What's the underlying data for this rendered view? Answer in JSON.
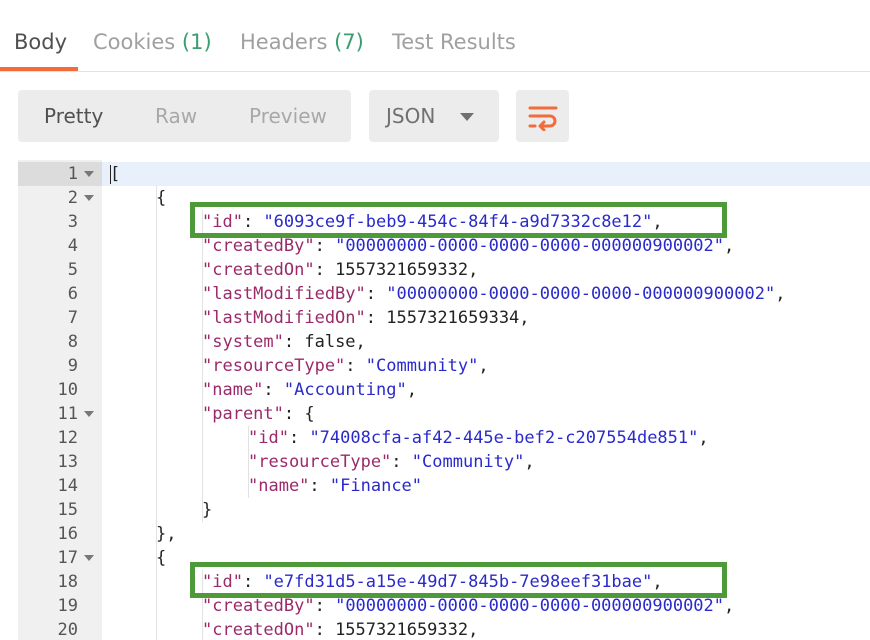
{
  "tabs": [
    {
      "label": "Body",
      "count": ""
    },
    {
      "label": "Cookies",
      "count": "(1)"
    },
    {
      "label": "Headers",
      "count": "(7)"
    },
    {
      "label": "Test Results",
      "count": ""
    }
  ],
  "toolbar": {
    "view_modes": [
      "Pretty",
      "Raw",
      "Preview"
    ],
    "active_view": "Pretty",
    "format": "JSON",
    "wrap_icon": "wrap-lines-icon",
    "accent_color": "#f26b3a"
  },
  "editor": {
    "line_numbers": [
      "1",
      "2",
      "3",
      "4",
      "5",
      "6",
      "7",
      "8",
      "9",
      "10",
      "11",
      "12",
      "13",
      "14",
      "15",
      "16",
      "17",
      "18",
      "19",
      "20"
    ],
    "lines": [
      [
        {
          "t": "p",
          "v": "["
        }
      ],
      [
        {
          "t": "p",
          "v": "{"
        }
      ],
      [
        {
          "t": "k",
          "v": "\"id\""
        },
        {
          "t": "p",
          "v": ": "
        },
        {
          "t": "s",
          "v": "\"6093ce9f-beb9-454c-84f4-a9d7332c8e12\""
        },
        {
          "t": "p",
          "v": ","
        }
      ],
      [
        {
          "t": "k",
          "v": "\"createdBy\""
        },
        {
          "t": "p",
          "v": ": "
        },
        {
          "t": "s",
          "v": "\"00000000-0000-0000-0000-000000900002\""
        },
        {
          "t": "p",
          "v": ","
        }
      ],
      [
        {
          "t": "k",
          "v": "\"createdOn\""
        },
        {
          "t": "p",
          "v": ": 1557321659332,"
        }
      ],
      [
        {
          "t": "k",
          "v": "\"lastModifiedBy\""
        },
        {
          "t": "p",
          "v": ": "
        },
        {
          "t": "s",
          "v": "\"00000000-0000-0000-0000-000000900002\""
        },
        {
          "t": "p",
          "v": ","
        }
      ],
      [
        {
          "t": "k",
          "v": "\"lastModifiedOn\""
        },
        {
          "t": "p",
          "v": ": 1557321659334,"
        }
      ],
      [
        {
          "t": "k",
          "v": "\"system\""
        },
        {
          "t": "p",
          "v": ": false,"
        }
      ],
      [
        {
          "t": "k",
          "v": "\"resourceType\""
        },
        {
          "t": "p",
          "v": ": "
        },
        {
          "t": "s",
          "v": "\"Community\""
        },
        {
          "t": "p",
          "v": ","
        }
      ],
      [
        {
          "t": "k",
          "v": "\"name\""
        },
        {
          "t": "p",
          "v": ": "
        },
        {
          "t": "s",
          "v": "\"Accounting\""
        },
        {
          "t": "p",
          "v": ","
        }
      ],
      [
        {
          "t": "k",
          "v": "\"parent\""
        },
        {
          "t": "p",
          "v": ": {"
        }
      ],
      [
        {
          "t": "k",
          "v": "\"id\""
        },
        {
          "t": "p",
          "v": ": "
        },
        {
          "t": "s",
          "v": "\"74008cfa-af42-445e-bef2-c207554de851\""
        },
        {
          "t": "p",
          "v": ","
        }
      ],
      [
        {
          "t": "k",
          "v": "\"resourceType\""
        },
        {
          "t": "p",
          "v": ": "
        },
        {
          "t": "s",
          "v": "\"Community\""
        },
        {
          "t": "p",
          "v": ","
        }
      ],
      [
        {
          "t": "k",
          "v": "\"name\""
        },
        {
          "t": "p",
          "v": ": "
        },
        {
          "t": "s",
          "v": "\"Finance\""
        }
      ],
      [
        {
          "t": "p",
          "v": "}"
        }
      ],
      [
        {
          "t": "p",
          "v": "},"
        }
      ],
      [
        {
          "t": "p",
          "v": "{"
        }
      ],
      [
        {
          "t": "k",
          "v": "\"id\""
        },
        {
          "t": "p",
          "v": ": "
        },
        {
          "t": "s",
          "v": "\"e7fd31d5-a15e-49d7-845b-7e98eef31bae\""
        },
        {
          "t": "p",
          "v": ","
        }
      ],
      [
        {
          "t": "k",
          "v": "\"createdBy\""
        },
        {
          "t": "p",
          "v": ": "
        },
        {
          "t": "s",
          "v": "\"00000000-0000-0000-0000-000000900002\""
        },
        {
          "t": "p",
          "v": ","
        }
      ],
      [
        {
          "t": "k",
          "v": "\"createdOn\""
        },
        {
          "t": "p",
          "v": ": 1557321659332,"
        }
      ]
    ],
    "fold_icon": "fold-arrow-icon",
    "highlight_color": "#4e9a3b"
  }
}
